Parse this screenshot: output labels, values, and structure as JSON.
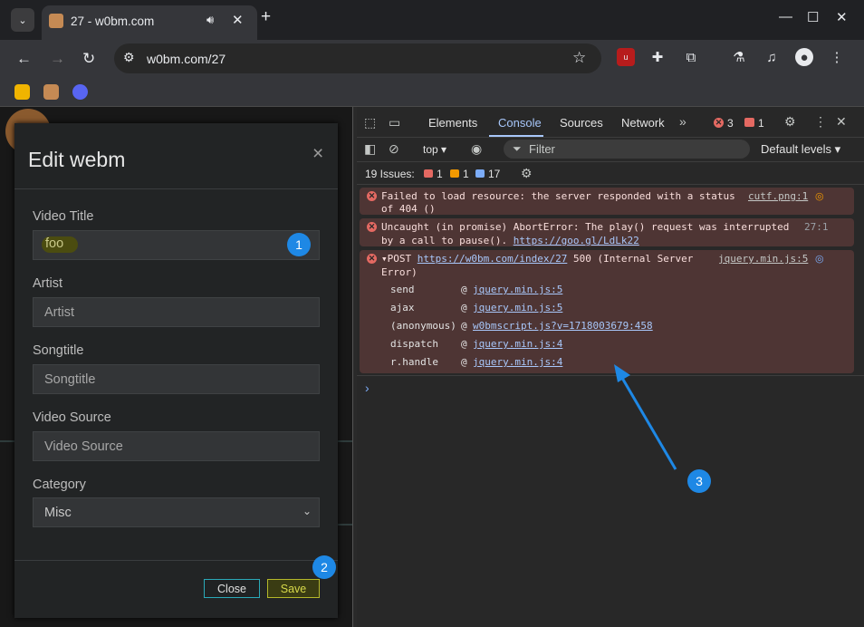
{
  "browser": {
    "tab_title": "27 - w0bm.com",
    "tab_dropdown_icon": "chevron-down-icon",
    "new_tab_label": "+",
    "url": "w0bm.com/27",
    "window_controls": [
      "—",
      "☐",
      "✕"
    ]
  },
  "page": {
    "modal": {
      "title": "Edit webm",
      "close_glyph": "×",
      "fields": [
        {
          "label": "Video Title",
          "value": "foo",
          "placeholder": ""
        },
        {
          "label": "Artist",
          "value": "",
          "placeholder": "Artist"
        },
        {
          "label": "Songtitle",
          "value": "",
          "placeholder": "Songtitle"
        },
        {
          "label": "Video Source",
          "value": "",
          "placeholder": "Video Source"
        },
        {
          "label": "Category",
          "value": "Misc",
          "placeholder": ""
        }
      ],
      "close_label": "Close",
      "save_label": "Save"
    }
  },
  "annotations": [
    "1",
    "2",
    "3"
  ],
  "devtools": {
    "tabs": [
      "Elements",
      "Console",
      "Sources",
      "Network"
    ],
    "active_tab": "Console",
    "error_count": "3",
    "issue_count": "1",
    "context": "top",
    "filter_placeholder": "Filter",
    "levels": "Default levels",
    "issues_label": "19 Issues:",
    "issues": {
      "errors": "1",
      "warnings": "1",
      "info": "17"
    },
    "messages": [
      {
        "text_line1": "Failed to load resource: the server responded with a status",
        "text_line2": "of 404 ()",
        "source": "cutf.png:1"
      },
      {
        "text_line1": "Uncaught (in promise) AbortError: The play() request was interrupted",
        "text_line2": "by a call to pause().",
        "link": "https://goo.gl/LdLk22",
        "source": "27:1"
      },
      {
        "prefix": "POST",
        "url": "https://w0bm.com/index/27",
        "suffix": "500 (Internal Server",
        "line2": "Error)",
        "source": "jquery.min.js:5",
        "stack": [
          {
            "fn": "send",
            "at": "@",
            "loc": "jquery.min.js:5"
          },
          {
            "fn": "ajax",
            "at": "@",
            "loc": "jquery.min.js:5"
          },
          {
            "fn": "(anonymous)",
            "at": "@",
            "loc": "w0bmscript.js?v=1718003679:458"
          },
          {
            "fn": "dispatch",
            "at": "@",
            "loc": "jquery.min.js:4"
          },
          {
            "fn": "r.handle",
            "at": "@",
            "loc": "jquery.min.js:4"
          }
        ]
      }
    ],
    "prompt": "›"
  }
}
